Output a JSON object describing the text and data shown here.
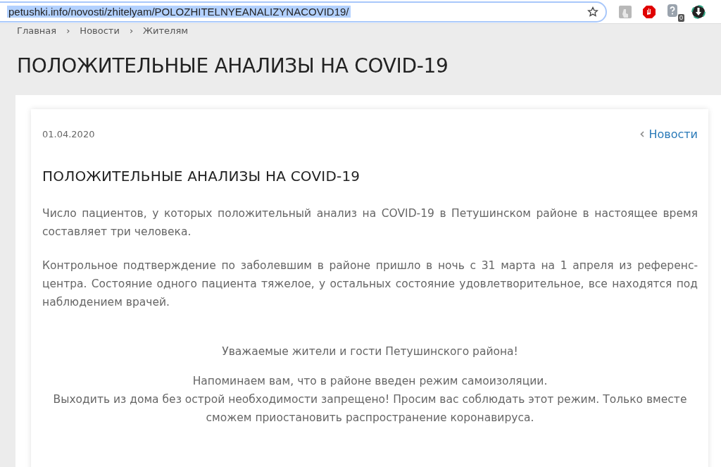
{
  "browser": {
    "url": "petushki.info/novosti/zhitelyam/POLOZHITELNYEANALIZYNACOVID19/",
    "url_selected": true,
    "extension_badge": "0"
  },
  "breadcrumbs": [
    {
      "label": "Главная"
    },
    {
      "label": "Новости"
    },
    {
      "label": "Жителям"
    }
  ],
  "breadcrumb_separator": "›",
  "page_title": "ПОЛОЖИТЕЛЬНЫЕ АНАЛИЗЫ НА COVID-19",
  "article": {
    "date": "01.04.2020",
    "back_link": "Новости",
    "title": "ПОЛОЖИТЕЛЬНЫЕ АНАЛИЗЫ НА COVID-19",
    "paragraphs": [
      "Число пациентов, у которых положительный анализ на COVID-19 в Петушинском районе в настоящее время составляет три человека.",
      "Контрольное подтверждение по заболевшим в районе пришло в ночь с 31 марта на 1 апреля из референс-центра. Состояние одного пациента тяжелое, у остальных состояние удовлетворительное, все находятся под наблюдением врачей."
    ],
    "notice": [
      [
        "Уважаемые жители и гости Петушинского района!"
      ],
      [
        "Напоминаем вам, что в районе введен режим самоизоляции.",
        "Выходить из дома без острой необходимости запрещено! Просим вас соблюдать этот режим. Только вместе сможем приостановить распространение коронавируса."
      ]
    ]
  }
}
